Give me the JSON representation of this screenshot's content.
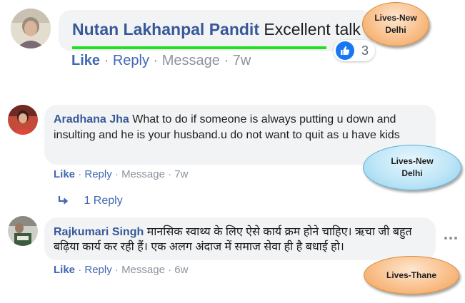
{
  "comments": [
    {
      "author": "Nutan Lakhanpal Pandit",
      "text": "Excellent talk",
      "actions": {
        "like": "Like",
        "sep1": "·",
        "reply": "Reply",
        "sep2": "·",
        "message": "Message",
        "sep3": "·",
        "time": "7w"
      },
      "reaction_count": "3",
      "callout": {
        "line1": "Lives-New",
        "line2": "Delhi"
      }
    },
    {
      "author": "Aradhana Jha",
      "text": "What to do if someone is always putting u down and insulting and he is your husband.u do not want to quit as u have kids",
      "actions": {
        "like": "Like",
        "sep1": "·",
        "reply": "Reply",
        "sep2": "·",
        "message": "Message",
        "sep3": "·",
        "time": "7w"
      },
      "replies_link": "1 Reply",
      "callout": {
        "line1": "Lives-New",
        "line2": "Delhi"
      }
    },
    {
      "author": "Rajkumari Singh",
      "text": "मानसिक स्वाथ्य के लिए ऐसे कार्य क्रम होने चाहिए। ऋचा जी बहुत बढ़िया कार्य कर रही हैं। एक अलग अंदाज में समाज सेवा ही है बधाई हो।",
      "actions": {
        "like": "Like",
        "sep1": "·",
        "reply": "Reply",
        "sep2": "·",
        "message": "Message",
        "sep3": "·",
        "time": "6w"
      },
      "callout": {
        "line1": "Lives-Thane"
      }
    }
  ],
  "colors": {
    "name": "#385898",
    "link": "#4267b2",
    "meta": "#8d949e",
    "bubble": "#f2f3f5",
    "underline": "#1ee21e"
  }
}
